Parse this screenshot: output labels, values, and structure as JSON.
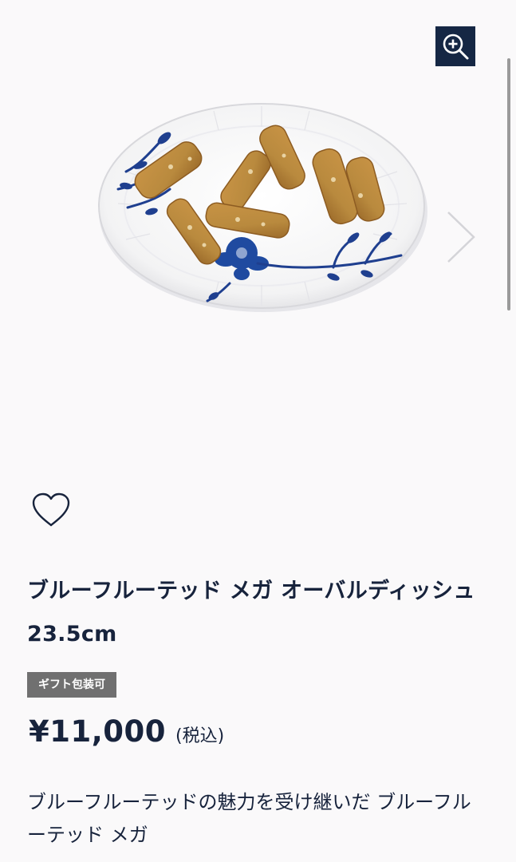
{
  "gallery": {
    "image_alt": "plate-with-biscotti",
    "zoom_icon": "zoom-in-icon",
    "next_icon": "chevron-right-icon"
  },
  "favorite": {
    "icon": "heart-outline-icon"
  },
  "product": {
    "title": "ブルーフルーテッド メガ オーバルディッシュ 23.5cm",
    "gift_badge": "ギフト包装可",
    "price": "¥11,000",
    "tax_note": "(税込)",
    "description": "ブルーフルーテッドの魅力を受け継いだ ブルーフルーテッド メガ"
  },
  "colors": {
    "accent_navy": "#152744",
    "text": "#17233c",
    "badge_gray": "#707070",
    "background": "#faf9fa"
  }
}
